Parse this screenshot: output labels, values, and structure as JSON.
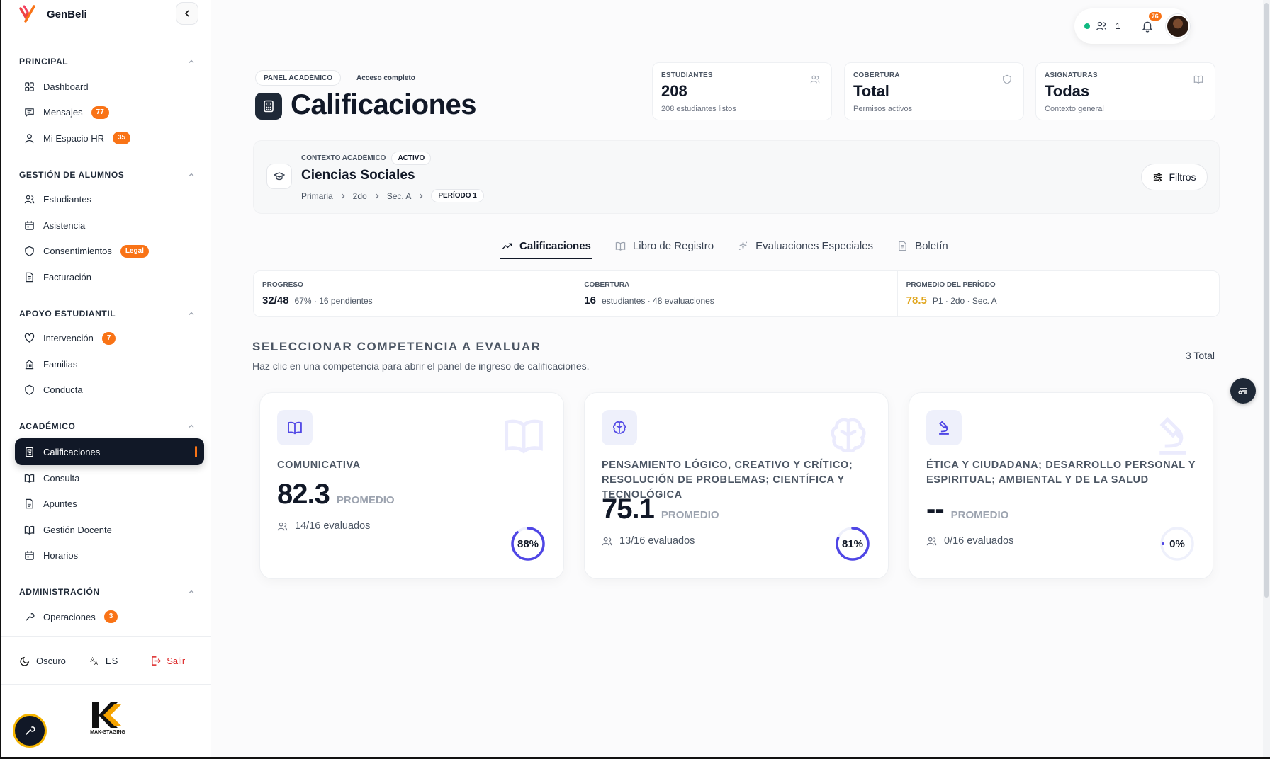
{
  "app": {
    "name": "GenBeli"
  },
  "sidebar": {
    "sections": [
      {
        "title": "PRINCIPAL",
        "items": [
          {
            "label": "Dashboard",
            "icon": "grid-icon"
          },
          {
            "label": "Mensajes",
            "icon": "message-icon",
            "badge": "77"
          },
          {
            "label": "Mi Espacio HR",
            "icon": "user-icon",
            "badge": "35"
          }
        ]
      },
      {
        "title": "GESTIÓN DE ALUMNOS",
        "items": [
          {
            "label": "Estudiantes",
            "icon": "users-icon"
          },
          {
            "label": "Asistencia",
            "icon": "calendar-icon"
          },
          {
            "label": "Consentimientos",
            "icon": "shield-icon",
            "badge": "Legal"
          },
          {
            "label": "Facturación",
            "icon": "file-icon"
          }
        ]
      },
      {
        "title": "APOYO ESTUDIANTIL",
        "items": [
          {
            "label": "Intervención",
            "icon": "heart-icon",
            "badge": "7"
          },
          {
            "label": "Familias",
            "icon": "building-icon"
          },
          {
            "label": "Conducta",
            "icon": "shield-icon"
          }
        ]
      },
      {
        "title": "ACADÉMICO",
        "items": [
          {
            "label": "Calificaciones",
            "icon": "calculator-icon",
            "active": true
          },
          {
            "label": "Consulta",
            "icon": "book-icon"
          },
          {
            "label": "Apuntes",
            "icon": "file-icon"
          },
          {
            "label": "Gestión Docente",
            "icon": "book-icon"
          },
          {
            "label": "Horarios",
            "icon": "calendar-icon"
          }
        ]
      },
      {
        "title": "ADMINISTRACIÓN",
        "items": [
          {
            "label": "Operaciones",
            "icon": "wrench-icon",
            "badge": "3"
          }
        ]
      }
    ],
    "footer": {
      "theme": "Oscuro",
      "language": "ES",
      "logout": "Salir"
    },
    "env_label": "MAK-STAGING"
  },
  "topbar": {
    "online_users": "1",
    "notifications": "76"
  },
  "header": {
    "chip_panel": "PANEL ACADÉMICO",
    "chip_access": "Acceso completo",
    "title": "Calificaciones",
    "stats": [
      {
        "label": "ESTUDIANTES",
        "value": "208",
        "sub": "208 estudiantes listos",
        "icon": "users-icon"
      },
      {
        "label": "COBERTURA",
        "value": "Total",
        "sub": "Permisos activos",
        "icon": "shield-icon"
      },
      {
        "label": "ASIGNATURAS",
        "value": "Todas",
        "sub": "Contexto general",
        "icon": "book-icon"
      }
    ]
  },
  "context": {
    "label": "CONTEXTO ACADÉMICO",
    "status": "ACTIVO",
    "subject": "Ciencias Sociales",
    "crumbs": [
      "Primaria",
      "2do",
      "Sec. A"
    ],
    "period": "PERÍODO 1",
    "filters_label": "Filtros"
  },
  "tabs": [
    {
      "label": "Calificaciones",
      "icon": "trending-up-icon",
      "active": true
    },
    {
      "label": "Libro de Registro",
      "icon": "book-icon"
    },
    {
      "label": "Evaluaciones Especiales",
      "icon": "sparkle-icon"
    },
    {
      "label": "Boletín",
      "icon": "file-icon"
    }
  ],
  "strip": {
    "progress": {
      "label": "PROGRESO",
      "value": "32/48",
      "detail": "67% · 16 pendientes"
    },
    "coverage": {
      "label": "COBERTURA",
      "value": "16",
      "detail": "estudiantes · 48 evaluaciones"
    },
    "average": {
      "label": "PROMEDIO DEL PERÍODO",
      "value": "78.5",
      "detail": "P1 · 2do · Sec. A"
    }
  },
  "competencies_section": {
    "title": "SELECCIONAR COMPETENCIA A EVALUAR",
    "subtitle": "Haz clic en una competencia para abrir el panel de ingreso de calificaciones.",
    "total": "3 Total"
  },
  "competencies": [
    {
      "name": "COMUNICATIVA",
      "score": "82.3",
      "score_label": "PROMEDIO",
      "evaluated": "14/16 evaluados",
      "percent": 88,
      "percent_label": "88%",
      "icon": "book-icon"
    },
    {
      "name": "PENSAMIENTO LÓGICO, CREATIVO Y CRÍTICO; RESOLUCIÓN DE PROBLEMAS; CIENTÍFICA Y TECNOLÓGICA",
      "score": "75.1",
      "score_label": "PROMEDIO",
      "evaluated": "13/16 evaluados",
      "percent": 81,
      "percent_label": "81%",
      "icon": "brain-icon"
    },
    {
      "name": "ÉTICA Y CIUDADANA; DESARROLLO PERSONAL Y ESPIRITUAL; AMBIENTAL Y DE LA SALUD",
      "score": "--",
      "score_label": "PROMEDIO",
      "evaluated": "0/16 evaluados",
      "percent": 0,
      "percent_label": "0%",
      "icon": "microscope-icon"
    }
  ],
  "colors": {
    "accent": "#4f46e5",
    "badge": "#f97316",
    "dark": "#111827",
    "gold": "#e0a51b",
    "danger": "#dc2626"
  }
}
